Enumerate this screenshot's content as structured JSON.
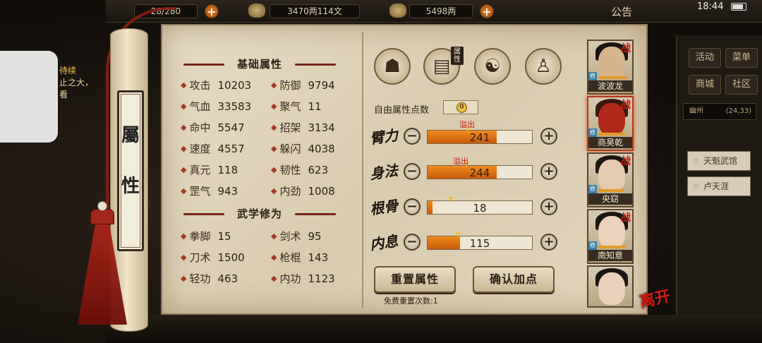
{
  "status_bar": {
    "time": "18:44"
  },
  "top_bar": {
    "stamina": "28/280",
    "money": "3470两114文",
    "gold": "5498两",
    "notice": "公告"
  },
  "left_overlay": {
    "line1": "待续",
    "line2": "止之大，",
    "line3": "看"
  },
  "scroll_title": [
    "屬",
    "性"
  ],
  "basic_stats": {
    "title": "基础属性",
    "items": [
      {
        "label": "攻击",
        "value": "10203"
      },
      {
        "label": "防御",
        "value": "9794"
      },
      {
        "label": "气血",
        "value": "33583"
      },
      {
        "label": "聚气",
        "value": "11"
      },
      {
        "label": "命中",
        "value": "5547"
      },
      {
        "label": "招架",
        "value": "3134"
      },
      {
        "label": "速度",
        "value": "4557"
      },
      {
        "label": "躲闪",
        "value": "4038"
      },
      {
        "label": "真元",
        "value": "118"
      },
      {
        "label": "韧性",
        "value": "623"
      },
      {
        "label": "罡气",
        "value": "943"
      },
      {
        "label": "内劲",
        "value": "1008"
      }
    ]
  },
  "martial_stats": {
    "title": "武学修为",
    "items": [
      {
        "label": "拳脚",
        "value": "15"
      },
      {
        "label": "剑术",
        "value": "95"
      },
      {
        "label": "刀术",
        "value": "1500"
      },
      {
        "label": "枪棍",
        "value": "143"
      },
      {
        "label": "轻功",
        "value": "463"
      },
      {
        "label": "内功",
        "value": "1123"
      }
    ]
  },
  "tabs": [
    {
      "icon": "hat-character-icon"
    },
    {
      "icon": "attributes-map-icon",
      "label": "属性"
    },
    {
      "icon": "bagua-icon"
    },
    {
      "icon": "meridian-body-icon"
    }
  ],
  "free_points": {
    "label": "自由属性点数",
    "value": "0"
  },
  "attributes": [
    {
      "name": "臂力",
      "value": "241",
      "fill": 0.66,
      "overflow": "溢出"
    },
    {
      "name": "身法",
      "value": "244",
      "fill": 0.66,
      "overflow": "溢出"
    },
    {
      "name": "根骨",
      "value": "18",
      "fill": 0.05,
      "overflow": ""
    },
    {
      "name": "内息",
      "value": "115",
      "fill": 0.31,
      "overflow": ""
    }
  ],
  "buttons": {
    "reset": "重置属性",
    "confirm": "确认加点",
    "reset_note": "免费重置次数:1"
  },
  "characters": [
    {
      "name": "波波龙",
      "battle": "战",
      "cultivation": "修",
      "hp": 0.85
    },
    {
      "name": "商昊乾",
      "battle": "战",
      "cultivation": "修",
      "hp": 0.8
    },
    {
      "name": "央窈",
      "battle": "战",
      "cultivation": "修",
      "hp": 0.75
    },
    {
      "name": "南知意",
      "battle": "战",
      "cultivation": "修",
      "hp": 0.8
    },
    {
      "name": "",
      "battle": "",
      "cultivation": "",
      "hp": 0
    }
  ],
  "leave": "离开",
  "side_menu": {
    "buttons": [
      "活动",
      "菜单",
      "商城",
      "社区"
    ],
    "location": "幽州",
    "coords": "(24,33)",
    "npcs": [
      "天魁武馆",
      "卢天涯"
    ]
  },
  "colors": {
    "accent_red": "#c01e12",
    "bar_orange": "#e07418"
  }
}
